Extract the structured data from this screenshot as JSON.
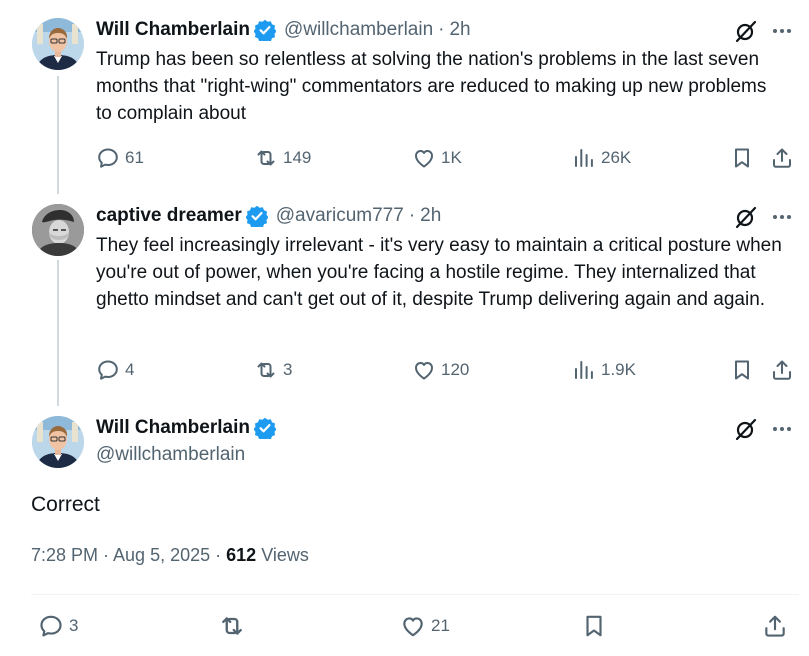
{
  "tweets": [
    {
      "name": "Will Chamberlain",
      "handle": "@willchamberlain",
      "time": "2h",
      "text": "Trump has been so relentless at solving the nation's problems in the last seven months that \"right-wing\" commentators are reduced to making up new problems to complain about",
      "replies": "61",
      "reposts": "149",
      "likes": "1K",
      "views": "26K"
    },
    {
      "name": "captive dreamer",
      "handle": "@avaricum777",
      "time": "2h",
      "text": "They feel increasingly irrelevant - it's very easy to maintain a critical posture when you're out of power, when you're facing a hostile regime.  They internalized that ghetto mindset and can't get out of it, despite Trump delivering again and again.",
      "replies": "4",
      "reposts": "3",
      "likes": "120",
      "views": "1.9K"
    }
  ],
  "main": {
    "name": "Will Chamberlain",
    "handle": "@willchamberlain",
    "text": "Correct",
    "timestamp": "7:28 PM · Aug 5, 2025",
    "views_count": "612",
    "views_label": "Views",
    "replies": "3",
    "reposts": "",
    "likes": "21"
  },
  "colors": {
    "verified": "#1d9bf0",
    "muted": "#536471",
    "text": "#0f1419"
  },
  "icons": [
    "verified-badge-icon",
    "grok-icon",
    "more-icon",
    "reply-icon",
    "repost-icon",
    "like-icon",
    "views-icon",
    "bookmark-icon",
    "share-icon"
  ]
}
